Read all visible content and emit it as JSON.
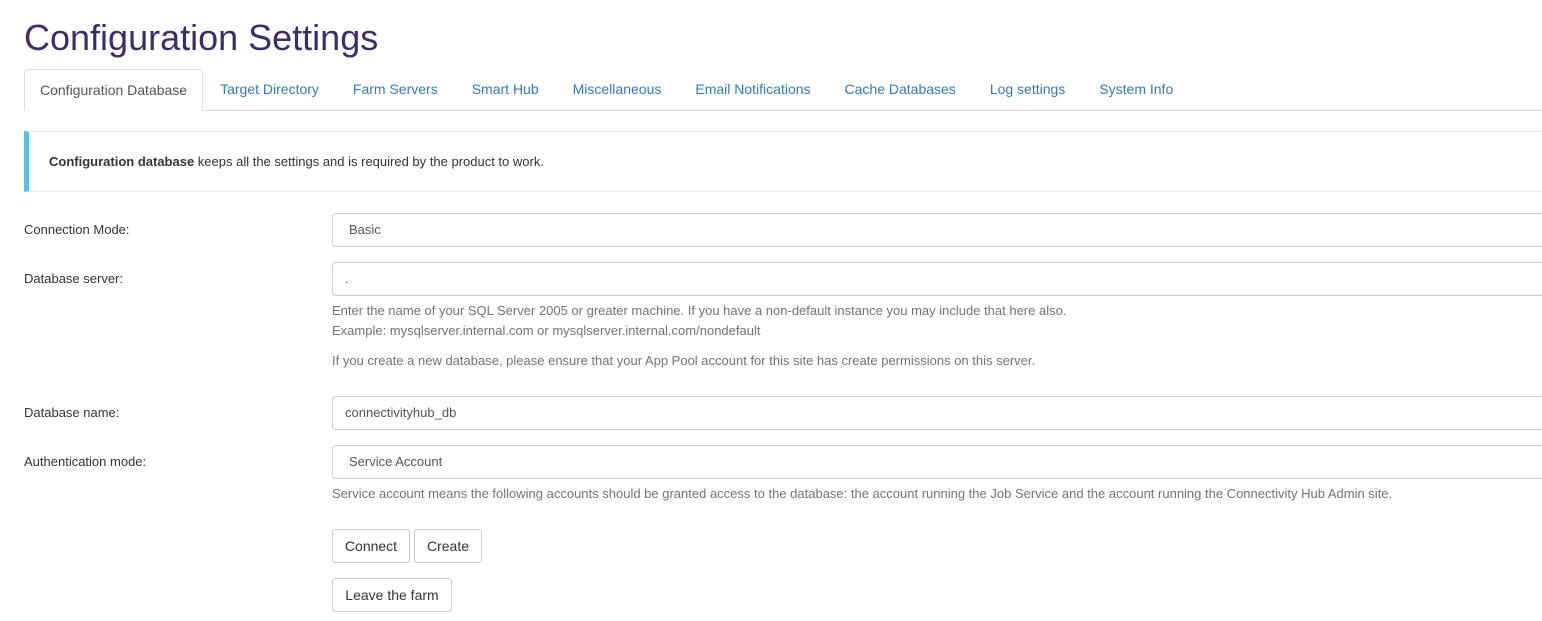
{
  "page": {
    "title": "Configuration Settings"
  },
  "tabs": [
    {
      "label": "Configuration Database",
      "active": true
    },
    {
      "label": "Target Directory"
    },
    {
      "label": "Farm Servers"
    },
    {
      "label": "Smart Hub"
    },
    {
      "label": "Miscellaneous"
    },
    {
      "label": "Email Notifications"
    },
    {
      "label": "Cache Databases"
    },
    {
      "label": "Log settings"
    },
    {
      "label": "System Info"
    }
  ],
  "callout": {
    "bold": "Configuration database",
    "text": " keeps all the settings and is required by the product to work."
  },
  "form": {
    "connection_mode": {
      "label": "Connection Mode:",
      "value": "Basic"
    },
    "database_server": {
      "label": "Database server:",
      "value": ".",
      "help_line1": "Enter the name of your SQL Server 2005 or greater machine. If you have a non-default instance you may include that here also.",
      "help_line2": "Example: mysqlserver.internal.com or mysqlserver.internal.com/nondefault",
      "help_line3": "If you create a new database, please ensure that your App Pool account for this site has create permissions on this server."
    },
    "database_name": {
      "label": "Database name:",
      "value": "connectivityhub_db"
    },
    "authentication_mode": {
      "label": "Authentication mode:",
      "value": "Service Account",
      "help": "Service account means the following accounts should be granted access to the database: the account running the Job Service and the account running the Connectivity Hub Admin site."
    }
  },
  "buttons": {
    "connect": "Connect",
    "create": "Create",
    "leave_farm": "Leave the farm"
  },
  "colors": {
    "title": "#3e2b6b",
    "tab_link": "#337ab7",
    "callout_accent": "#5bc0de"
  }
}
